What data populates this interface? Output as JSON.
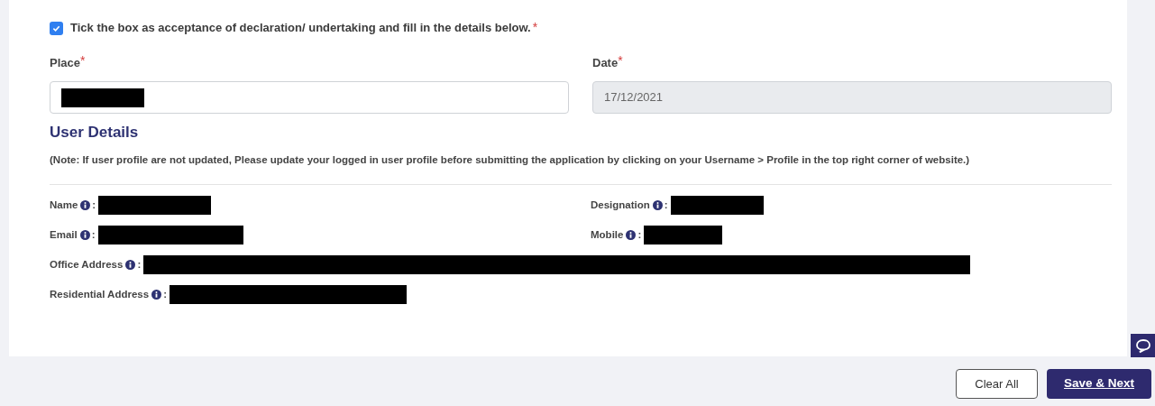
{
  "declaration": {
    "checked": true,
    "text": "Tick the box as acceptance of declaration/ undertaking and fill in the details below.",
    "required_mark": "*"
  },
  "fields": [
    {
      "label": "Place",
      "required_mark": "*",
      "redacted": true,
      "disabled": false
    },
    {
      "label": "Date",
      "required_mark": "*",
      "value": "17/12/2021",
      "redacted": false,
      "disabled": true
    }
  ],
  "user_details": {
    "heading": "User Details",
    "note": "(Note: If user profile are not updated, Please update your logged in user profile before submitting the application by clicking on your Username > Profile in the top right corner of website.)",
    "items": [
      {
        "label": "Name",
        "separator": ":",
        "redacted": true
      },
      {
        "label": "Designation",
        "separator": ":",
        "redacted": true
      },
      {
        "label": "Email",
        "separator": ":",
        "redacted": true
      },
      {
        "label": "Mobile",
        "separator": ":",
        "redacted": true
      },
      {
        "label": "Office Address",
        "separator": ":",
        "redacted": true
      },
      {
        "label": "Residential Address",
        "separator": ":",
        "redacted": true
      }
    ]
  },
  "buttons": [
    {
      "label": "Clear All",
      "kind": "outline"
    },
    {
      "label": "Save & Next",
      "kind": "primary"
    }
  ]
}
